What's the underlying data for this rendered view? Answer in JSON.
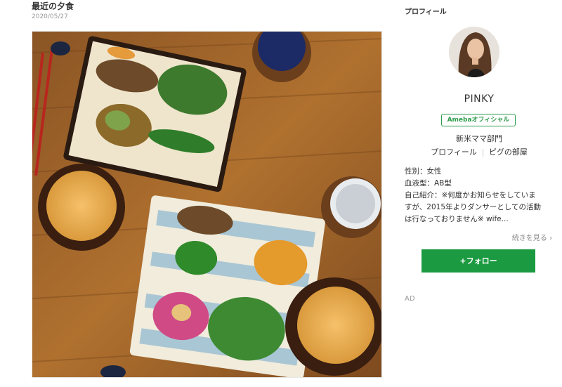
{
  "entry": {
    "title": "最近の夕食",
    "date": "2020/05/27"
  },
  "sidebar": {
    "heading": "プロフィール",
    "name": "PINKY",
    "badge": "Amebaオフィシャル",
    "category": "新米ママ部門",
    "links": [
      "プロフィール",
      "ピグの部屋"
    ],
    "info": [
      "性別：女性",
      "血液型：AB型",
      "自己紹介：※何度かお知らせをしていま",
      "すが、2015年よりダンサーとしての活動",
      "は行なっておりません※ wife..."
    ],
    "more": "続きを見る ›",
    "follow": "+フォロー",
    "ad": "AD"
  },
  "colors": {
    "follow_button": "#1b9a41",
    "badge": "#2d9c4c",
    "table_wood": "#a0642a"
  }
}
